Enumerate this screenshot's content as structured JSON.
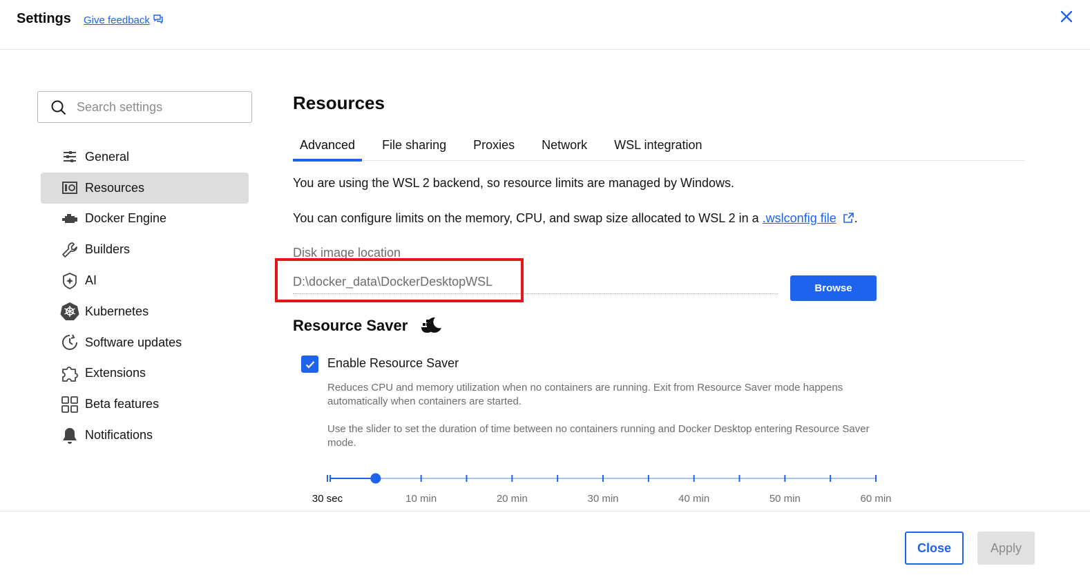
{
  "header": {
    "title": "Settings",
    "feedback_label": "Give feedback"
  },
  "search": {
    "placeholder": "Search settings"
  },
  "sidebar": {
    "items": [
      {
        "label": "General",
        "icon": "sliders-icon"
      },
      {
        "label": "Resources",
        "icon": "resources-icon",
        "active": true
      },
      {
        "label": "Docker Engine",
        "icon": "engine-icon"
      },
      {
        "label": "Builders",
        "icon": "wrench-icon"
      },
      {
        "label": "AI",
        "icon": "ai-sparkle-icon"
      },
      {
        "label": "Kubernetes",
        "icon": "kubernetes-icon"
      },
      {
        "label": "Software updates",
        "icon": "clock-refresh-icon"
      },
      {
        "label": "Extensions",
        "icon": "puzzle-icon"
      },
      {
        "label": "Beta features",
        "icon": "grid-icon"
      },
      {
        "label": "Notifications",
        "icon": "bell-icon"
      }
    ]
  },
  "main": {
    "title": "Resources",
    "tabs": [
      {
        "label": "Advanced",
        "active": true
      },
      {
        "label": "File sharing"
      },
      {
        "label": "Proxies"
      },
      {
        "label": "Network"
      },
      {
        "label": "WSL integration"
      }
    ],
    "wsl_notice": "You are using the WSL 2 backend, so resource limits are managed by Windows.",
    "wslconfig_prefix": "You can configure limits on the memory, CPU, and swap size allocated to WSL 2 in a ",
    "wslconfig_link": ".wslconfig file",
    "wslconfig_suffix": ".",
    "disk_image_label": "Disk image location",
    "disk_image_value": "D:\\docker_data\\DockerDesktopWSL",
    "browse_label": "Browse",
    "resource_saver_title": "Resource Saver",
    "enable_label": "Enable Resource Saver",
    "enable_checked": true,
    "desc1": "Reduces CPU and memory utilization when no containers are running. Exit from Resource Saver mode happens automatically when containers are started.",
    "desc2": "Use the slider to set the duration of time between no containers running and Docker Desktop entering Resource Saver mode.",
    "slider": {
      "labels": [
        "30 sec",
        "10 min",
        "20 min",
        "30 min",
        "40 min",
        "50 min",
        "60 min"
      ],
      "min_minutes": 0.5,
      "max_minutes": 60,
      "value_minutes": 5
    }
  },
  "footer": {
    "close_label": "Close",
    "apply_label": "Apply"
  },
  "colors": {
    "accent": "#1d63ed",
    "highlight": "#e3161b",
    "active_nav_bg": "#dddddd"
  }
}
